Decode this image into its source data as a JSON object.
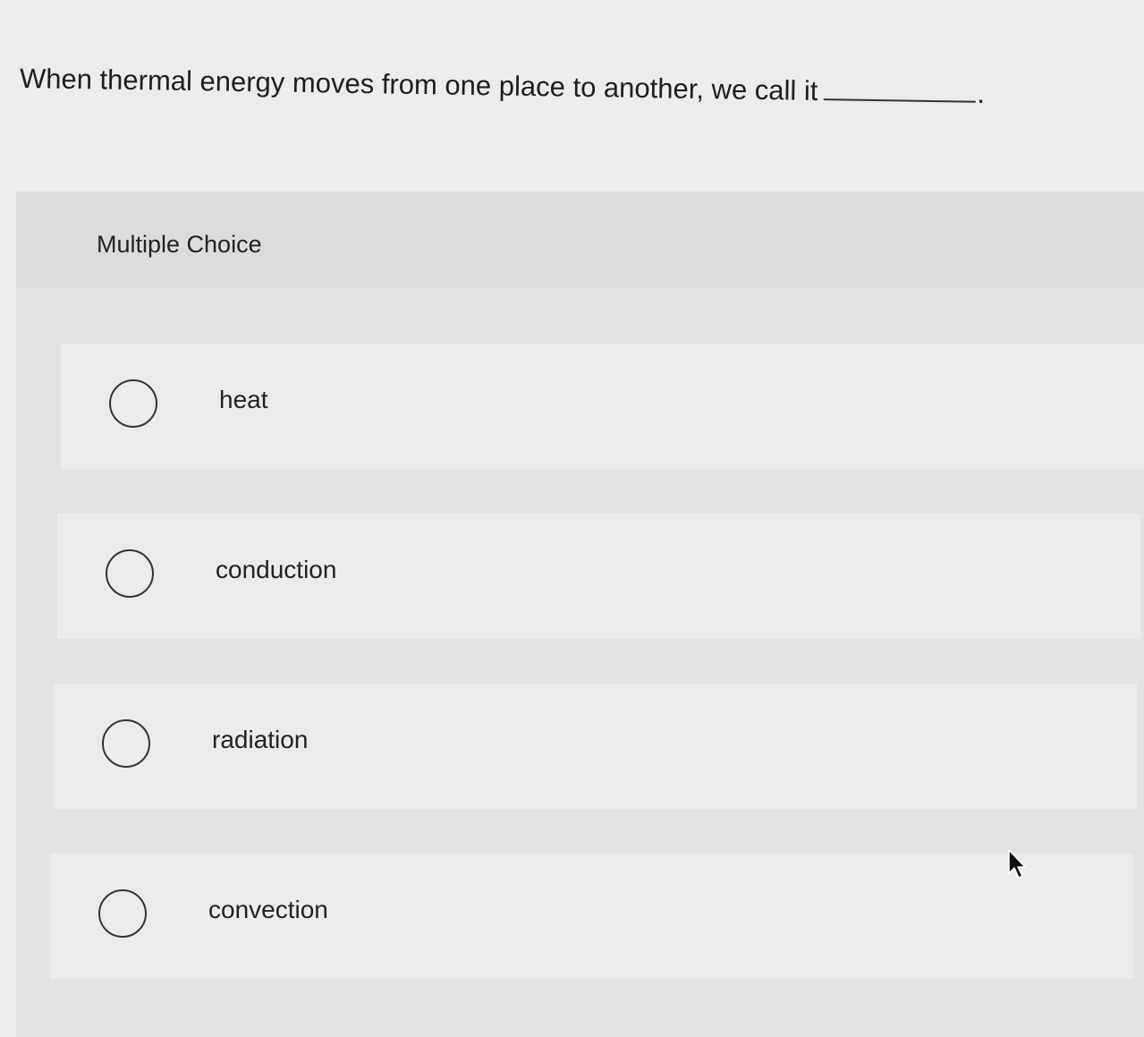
{
  "question": {
    "text": "When thermal energy moves from one place to another, we call it",
    "suffix": "."
  },
  "panel": {
    "title": "Multiple Choice"
  },
  "options": [
    {
      "label": "heat",
      "selected": false
    },
    {
      "label": "conduction",
      "selected": false
    },
    {
      "label": "radiation",
      "selected": false
    },
    {
      "label": "convection",
      "selected": false
    }
  ],
  "cursor": {
    "icon": "arrow-cursor-icon"
  }
}
